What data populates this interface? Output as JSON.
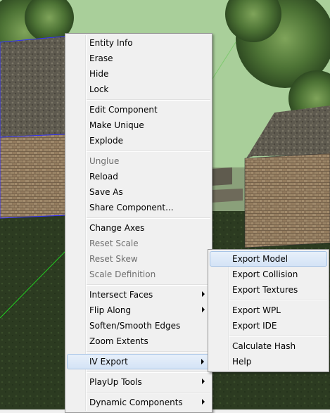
{
  "context_menu": {
    "groups": [
      [
        {
          "label": "Entity Info",
          "enabled": true
        },
        {
          "label": "Erase",
          "enabled": true
        },
        {
          "label": "Hide",
          "enabled": true
        },
        {
          "label": "Lock",
          "enabled": true
        }
      ],
      [
        {
          "label": "Edit Component",
          "enabled": true
        },
        {
          "label": "Make Unique",
          "enabled": true
        },
        {
          "label": "Explode",
          "enabled": true
        }
      ],
      [
        {
          "label": "Unglue",
          "enabled": false
        },
        {
          "label": "Reload",
          "enabled": true
        },
        {
          "label": "Save As",
          "enabled": true
        },
        {
          "label": "Share Component...",
          "enabled": true
        }
      ],
      [
        {
          "label": "Change Axes",
          "enabled": true
        },
        {
          "label": "Reset Scale",
          "enabled": false
        },
        {
          "label": "Reset Skew",
          "enabled": false
        },
        {
          "label": "Scale Definition",
          "enabled": false
        }
      ],
      [
        {
          "label": "Intersect Faces",
          "enabled": true,
          "submenu": true
        },
        {
          "label": "Flip Along",
          "enabled": true,
          "submenu": true
        },
        {
          "label": "Soften/Smooth Edges",
          "enabled": true
        },
        {
          "label": "Zoom Extents",
          "enabled": true
        }
      ],
      [
        {
          "label": "IV Export",
          "enabled": true,
          "submenu": true,
          "highlighted": true
        }
      ],
      [
        {
          "label": "PlayUp Tools",
          "enabled": true,
          "submenu": true
        }
      ],
      [
        {
          "label": "Dynamic Components",
          "enabled": true,
          "submenu": true
        }
      ]
    ]
  },
  "iv_export_submenu": {
    "groups": [
      [
        {
          "label": "Export Model",
          "highlighted": true
        },
        {
          "label": "Export Collision"
        },
        {
          "label": "Export Textures"
        }
      ],
      [
        {
          "label": "Export WPL"
        },
        {
          "label": "Export IDE"
        }
      ],
      [
        {
          "label": "Calculate Hash"
        },
        {
          "label": "Help"
        }
      ]
    ]
  },
  "colors": {
    "sky": "#a9cf9a",
    "ground": "#2c3b21",
    "menu_bg": "#f0f0f0",
    "highlight": "#d4e3f6"
  }
}
